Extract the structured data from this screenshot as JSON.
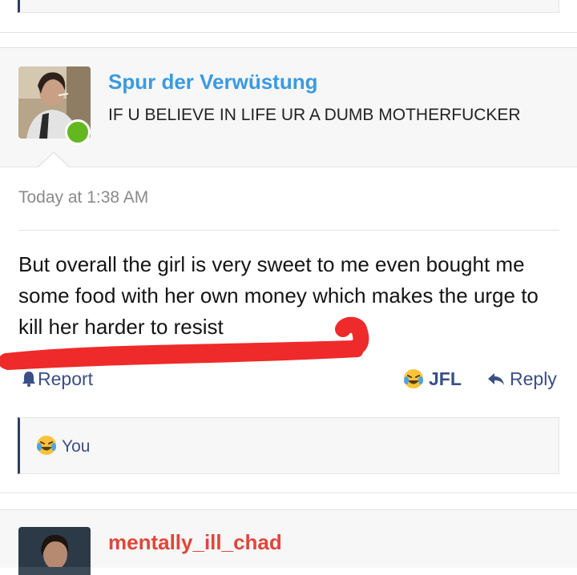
{
  "post": {
    "username": "Spur der Verwüstung",
    "username_color": "#3a9ae0",
    "user_title": "IF U BELIEVE IN LIFE UR A DUMB MOTHERFUCKER",
    "online_status_color": "#63b81f",
    "timestamp": "Today at 1:38 AM",
    "body": "But overall the girl is very sweet to me even bought me some food with her own money which makes the urge to kill her harder to resist",
    "annotation_color": "#ee2a2a"
  },
  "actions": {
    "report_label": "Report",
    "report_icon": "bell-icon",
    "reaction_label": "JFL",
    "reaction_icon": "laughing-crying-emoji-icon",
    "reply_label": "Reply",
    "reply_icon": "reply-arrow-icon"
  },
  "reactions_summary": {
    "icon": "laughing-crying-emoji-icon",
    "label": "You"
  },
  "next_post": {
    "username": "mentally_ill_chad",
    "username_color": "#e0463a"
  },
  "colors": {
    "accent": "#3b4f86",
    "quote_border": "#2f3d66",
    "panel_bg": "#f7f7f7"
  }
}
